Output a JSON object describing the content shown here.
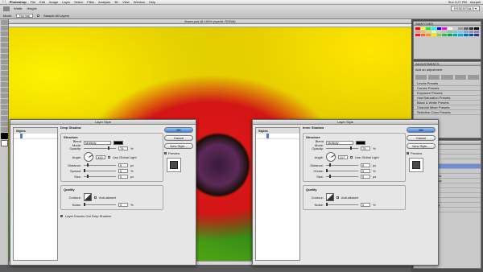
{
  "menubar": {
    "app": "Photoshop",
    "items": [
      "File",
      "Edit",
      "Image",
      "Layer",
      "Select",
      "Filter",
      "Analysis",
      "3D",
      "View",
      "Window",
      "Help"
    ],
    "clock": "Sun 3:27 PM",
    "user": "rkorpeli"
  },
  "options": {
    "width_label": "Width:",
    "height_label": "Height:",
    "mode_label": "Mode:",
    "mode_value": "Normal",
    "sample_all": "Sample All Layers",
    "essentials": "ESSENTIALS ▾"
  },
  "document": {
    "title": "flower.psd @ 100% (eye/ld, RGB/8)",
    "status": "Doc: 3.43M/50.9M"
  },
  "panels": {
    "swatches_title": "SWATCHES",
    "swatch_colors": [
      "#ff0000",
      "#ffff00",
      "#00ff00",
      "#00ffff",
      "#0000ff",
      "#ff00ff",
      "#ffffff",
      "#cccccc",
      "#999999",
      "#666666",
      "#333333",
      "#000000",
      "#f7977a",
      "#fbad82",
      "#fdc68c",
      "#fff79a",
      "#c4df9b",
      "#a2d39c",
      "#82ca9c",
      "#7bcdc8",
      "#6ecff6",
      "#7ea7d8",
      "#8493ca",
      "#8882be",
      "#ed1c24",
      "#f26522",
      "#f7941d",
      "#fff200",
      "#8dc73f",
      "#39b54a",
      "#00a651",
      "#00a99d",
      "#00aeef",
      "#0072bc",
      "#0054a6",
      "#2e3192"
    ],
    "adjust_title": "ADJUSTMENTS",
    "adjust_label": "Add an adjustment",
    "presets": [
      "Levels Presets",
      "Curves Presets",
      "Exposure Presets",
      "Hue/Saturation Presets",
      "Black & White Presets",
      "Channel Mixer Presets",
      "Selective Color Presets"
    ],
    "layers_title": "LAYERS",
    "layers": [
      "flare shadow",
      "right eye",
      "left eye",
      "highlights",
      "eyeball",
      "Effects",
      "Drop Shadow",
      "Inner Shadow",
      "eye shadow",
      "overlay circle",
      "mouth",
      "Features",
      "Background sky",
      "Background"
    ]
  },
  "dialogs": [
    {
      "title": "Layer Style",
      "styles_header": "Styles",
      "styles": [
        {
          "label": "Blending Options: Default",
          "checked": null,
          "indent": false,
          "selected": false
        },
        {
          "label": "Drop Shadow",
          "checked": true,
          "indent": false,
          "selected": true
        },
        {
          "label": "Inner Shadow",
          "checked": true,
          "indent": false,
          "selected": false
        },
        {
          "label": "Outer Glow",
          "checked": false,
          "indent": false,
          "selected": false
        },
        {
          "label": "Inner Glow",
          "checked": false,
          "indent": false,
          "selected": false
        },
        {
          "label": "Bevel and Emboss",
          "checked": false,
          "indent": false,
          "selected": false
        },
        {
          "label": "Contour",
          "checked": false,
          "indent": true,
          "selected": false
        },
        {
          "label": "Texture",
          "checked": false,
          "indent": true,
          "selected": false
        },
        {
          "label": "Satin",
          "checked": false,
          "indent": false,
          "selected": false
        },
        {
          "label": "Color Overlay",
          "checked": false,
          "indent": false,
          "selected": false
        },
        {
          "label": "Gradient Overlay",
          "checked": false,
          "indent": false,
          "selected": false
        },
        {
          "label": "Pattern Overlay",
          "checked": false,
          "indent": false,
          "selected": false
        },
        {
          "label": "Stroke",
          "checked": false,
          "indent": false,
          "selected": false
        }
      ],
      "section": "Drop Shadow",
      "group1": "Structure",
      "blend_label": "Blend Mode:",
      "blend_value": "Multiply",
      "opacity_label": "Opacity:",
      "opacity_value": "75",
      "angle_label": "Angle:",
      "angle_value": "120",
      "global_label": "Use Global Light",
      "distance_label": "Distance:",
      "distance_value": "5",
      "second_label": "Spread:",
      "second_value": "0",
      "size_label": "Size:",
      "size_value": "5",
      "px": "px",
      "pct": "%",
      "group2": "Quality",
      "contour_label": "Contour:",
      "antialias": "Anti-aliased",
      "noise_label": "Noise:",
      "noise_value": "0",
      "knock": "Layer Knocks Out Drop Shadow",
      "ok": "OK",
      "cancel": "Cancel",
      "newstyle": "New Style...",
      "preview": "Preview"
    },
    {
      "title": "Layer Style",
      "styles_header": "Styles",
      "styles": [
        {
          "label": "Blending Options: Default",
          "checked": null,
          "indent": false,
          "selected": false
        },
        {
          "label": "Drop Shadow",
          "checked": true,
          "indent": false,
          "selected": false
        },
        {
          "label": "Inner Shadow",
          "checked": true,
          "indent": false,
          "selected": true
        },
        {
          "label": "Outer Glow",
          "checked": false,
          "indent": false,
          "selected": false
        },
        {
          "label": "Inner Glow",
          "checked": false,
          "indent": false,
          "selected": false
        },
        {
          "label": "Bevel and Emboss",
          "checked": false,
          "indent": false,
          "selected": false
        },
        {
          "label": "Contour",
          "checked": false,
          "indent": true,
          "selected": false
        },
        {
          "label": "Texture",
          "checked": false,
          "indent": true,
          "selected": false
        },
        {
          "label": "Satin",
          "checked": false,
          "indent": false,
          "selected": false
        },
        {
          "label": "Color Overlay",
          "checked": false,
          "indent": false,
          "selected": false
        },
        {
          "label": "Gradient Overlay",
          "checked": false,
          "indent": false,
          "selected": false
        },
        {
          "label": "Pattern Overlay",
          "checked": false,
          "indent": false,
          "selected": false
        },
        {
          "label": "Stroke",
          "checked": false,
          "indent": false,
          "selected": false
        }
      ],
      "section": "Inner Shadow",
      "group1": "Structure",
      "blend_label": "Blend Mode:",
      "blend_value": "Multiply",
      "opacity_label": "Opacity:",
      "opacity_value": "75",
      "angle_label": "Angle:",
      "angle_value": "127",
      "global_label": "Use Global Light",
      "distance_label": "Distance:",
      "distance_value": "5",
      "second_label": "Choke:",
      "second_value": "0",
      "size_label": "Size:",
      "size_value": "5",
      "px": "px",
      "pct": "%",
      "group2": "Quality",
      "contour_label": "Contour:",
      "antialias": "Anti-aliased",
      "noise_label": "Noise:",
      "noise_value": "0",
      "knock": "",
      "ok": "OK",
      "cancel": "Cancel",
      "newstyle": "New Style...",
      "preview": "Preview"
    }
  ]
}
